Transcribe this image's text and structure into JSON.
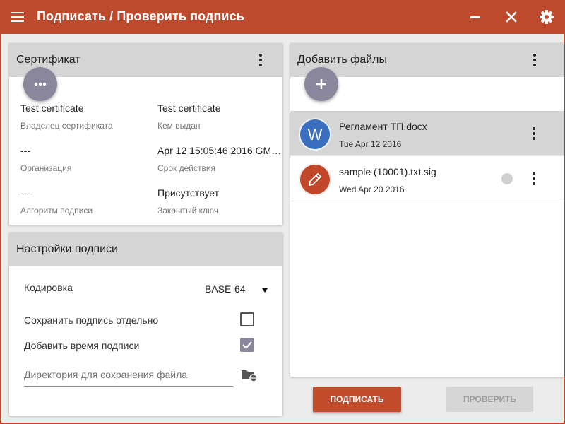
{
  "app": {
    "title": "Подписать / Проверить подпись",
    "icons": {
      "menu": "menu-icon",
      "minimize": "minimize-icon",
      "close": "close-icon",
      "settings": "gear-icon"
    },
    "colors": {
      "accent": "#bd4a2c",
      "fab": "#8a879c",
      "word_blue": "#3a6fc0",
      "sig_red": "#c2472a"
    }
  },
  "certificate": {
    "title": "Сертификат",
    "fields": [
      {
        "value": "Test certificate",
        "label": "Владелец сертификата"
      },
      {
        "value": "Test certificate",
        "label": "Кем выдан"
      },
      {
        "value": "---",
        "label": "Организация"
      },
      {
        "value": "Apr 12 15:05:46 2016 GMT ...",
        "label": "Срок действия"
      },
      {
        "value": "---",
        "label": "Алгоритм подписи"
      },
      {
        "value": "Присутствует",
        "label": "Закрытый ключ"
      }
    ]
  },
  "settings": {
    "title": "Настройки подписи",
    "encoding_label": "Кодировка",
    "encoding_value": "BASE-64",
    "detached_label": "Сохранить подпись отдельно",
    "detached_checked": false,
    "timestamp_label": "Добавить время подписи",
    "timestamp_checked": true,
    "directory_placeholder": "Директория для сохранения файла"
  },
  "files": {
    "title": "Добавить файлы",
    "items": [
      {
        "name": "Регламент ТП.docx",
        "date": "Tue Apr 12 2016",
        "avatar_letter": "W",
        "selected": true
      },
      {
        "name": "sample (10001).txt.sig",
        "date": "Wed Apr 20 2016",
        "avatar_icon": "pencil-icon",
        "selected": false
      }
    ]
  },
  "actions": {
    "sign_label": "ПОДПИСАТЬ",
    "verify_label": "ПРОВЕРИТЬ"
  }
}
